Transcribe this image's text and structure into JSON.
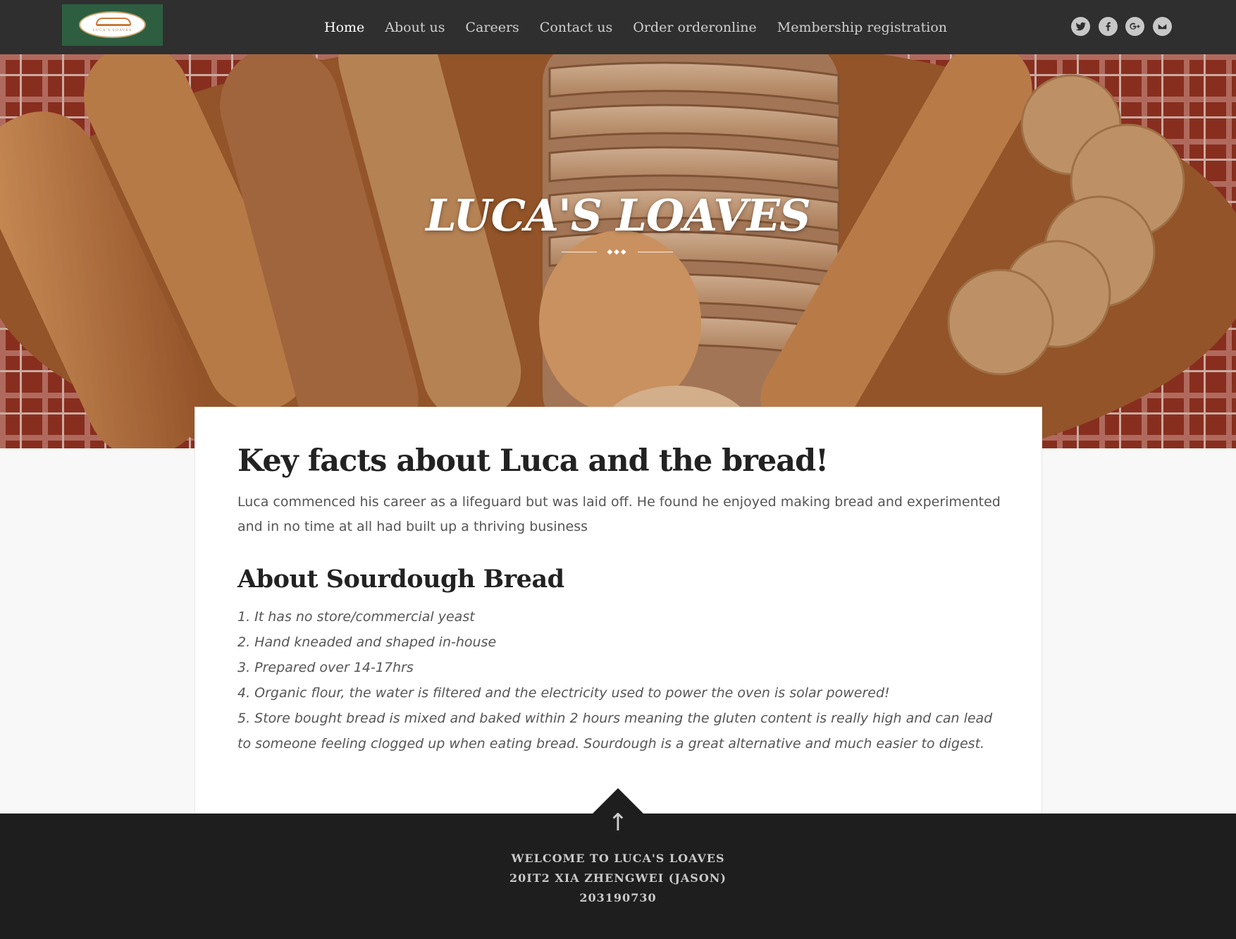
{
  "nav": {
    "logo_icon": "lucas-loaves-logo",
    "items": [
      {
        "label": "Home",
        "active": true
      },
      {
        "label": "About us",
        "active": false
      },
      {
        "label": "Careers",
        "active": false
      },
      {
        "label": "Contact us",
        "active": false
      },
      {
        "label": "Order orderonline",
        "active": false
      },
      {
        "label": "Membership registration",
        "active": false
      }
    ],
    "social": [
      "twitter-icon",
      "facebook-icon",
      "google-plus-icon",
      "email-icon"
    ]
  },
  "hero": {
    "title": "LUCA'S LOAVES",
    "divider_glyph": "◆◆◆"
  },
  "content": {
    "heading": "Key facts about Luca and the bread!",
    "intro": "Luca commenced his career as a lifeguard but was laid off. He found he enjoyed making bread and experimented and in no time at all had built up a thriving business",
    "subheading": "About Sourdough Bread",
    "facts": [
      "1. It has no store/commercial yeast",
      "2. Hand kneaded and shaped in-house",
      "3. Prepared over 14-17hrs",
      "4. Organic flour, the water is filtered and the electricity used to power the oven is solar powered!",
      "5. Store bought bread is mixed and baked within 2 hours meaning the gluten content is really high and can lead to someone feeling clogged up when eating bread. Sourdough is a great alternative and much easier to digest."
    ]
  },
  "footer": {
    "back_to_top": "↑",
    "lines": [
      "WELCOME TO LUCA'S LOAVES",
      "20IT2 XIA ZHENGWEI (JASON)",
      "203190730"
    ]
  },
  "colors": {
    "nav_bg": "#2f2f2f",
    "footer_bg": "#1e1e1e",
    "logo_bg": "#2d5e40"
  }
}
